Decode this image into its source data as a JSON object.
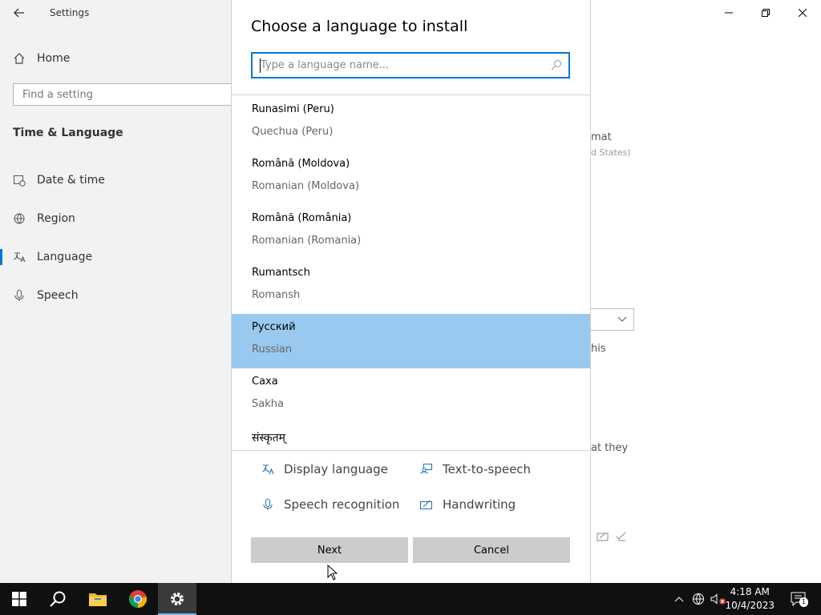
{
  "window": {
    "title": "Settings",
    "search_placeholder": "Find a setting",
    "home_label": "Home",
    "section_title": "Time & Language",
    "nav": [
      {
        "label": "Date & time",
        "icon": "calendar-clock-icon"
      },
      {
        "label": "Region",
        "icon": "globe-icon"
      },
      {
        "label": "Language",
        "icon": "language-icon"
      },
      {
        "label": "Speech",
        "icon": "microphone-icon"
      }
    ],
    "selected_nav": "Language",
    "background_fragments": [
      "mat",
      "d States)",
      "his",
      "at they"
    ]
  },
  "dialog": {
    "title": "Choose a language to install",
    "search_placeholder": "Type a language name...",
    "languages": [
      {
        "native": "Runasimi (Peru)",
        "english": "Quechua (Peru)"
      },
      {
        "native": "Română (Moldova)",
        "english": "Romanian (Moldova)"
      },
      {
        "native": "Română (România)",
        "english": "Romanian (Romania)"
      },
      {
        "native": "Rumantsch",
        "english": "Romansh"
      },
      {
        "native": "Русский",
        "english": "Russian",
        "selected": true
      },
      {
        "native": "Саха",
        "english": "Sakha"
      },
      {
        "native": "संस्कृतम्",
        "english": ""
      }
    ],
    "features": [
      {
        "label": "Display language",
        "icon": "display-language-icon"
      },
      {
        "label": "Text-to-speech",
        "icon": "text-to-speech-icon"
      },
      {
        "label": "Speech recognition",
        "icon": "microphone-icon"
      },
      {
        "label": "Handwriting",
        "icon": "handwriting-icon"
      }
    ],
    "next_label": "Next",
    "cancel_label": "Cancel"
  },
  "taskbar": {
    "apps": [
      "start-icon",
      "search-icon",
      "file-explorer-icon",
      "chrome-icon",
      "settings-icon"
    ],
    "active_app": "settings-icon",
    "time": "4:18 AM",
    "date": "10/4/2023",
    "notification_count": "1"
  },
  "colors": {
    "accent": "#0078d7",
    "selection": "#99c9ef",
    "taskbar": "#101010"
  }
}
